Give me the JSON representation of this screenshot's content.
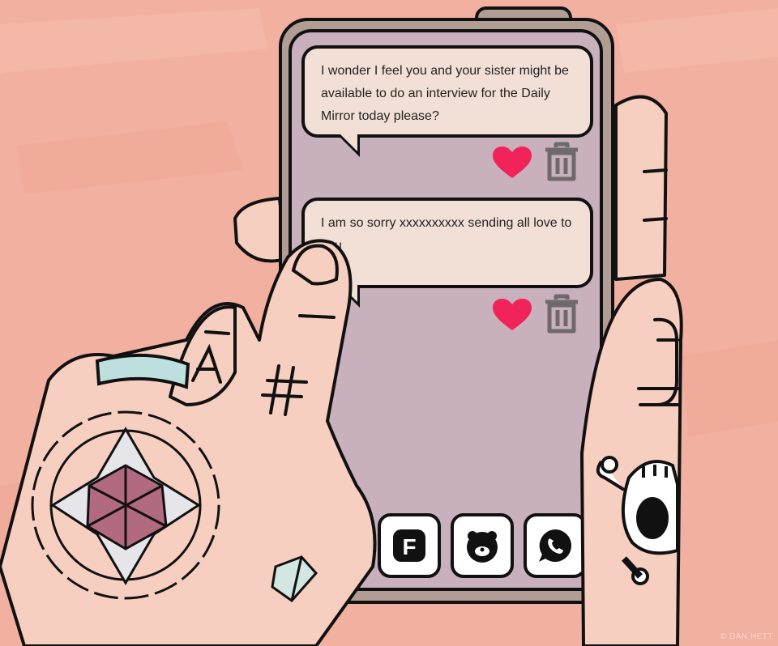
{
  "messages": [
    {
      "text": "I wonder I feel you and your sister might be available to do an interview for the Daily Mirror today please?"
    },
    {
      "text": "I am so sorry xxxxxxxxxx sending all love to you"
    }
  ],
  "actions": {
    "like_icon": "heart-icon",
    "delete_icon": "trash-icon",
    "like_color": "#f0245a",
    "delete_color": "#6e6a6c"
  },
  "dock": [
    {
      "id": "messages",
      "icon": "message-icon"
    },
    {
      "id": "facebook",
      "icon": "facebook-icon",
      "letter": "F"
    },
    {
      "id": "bear-app",
      "icon": "bear-icon"
    },
    {
      "id": "whatsapp",
      "icon": "whatsapp-icon"
    }
  ],
  "colors": {
    "background": "#f2b0a0",
    "skin": "#f7cfc0",
    "screen": "#c8b0bc",
    "phone_frame": "#b19d93",
    "bubble": "#f2e0d6",
    "outline": "#111111"
  },
  "credit": "© DAN HETT"
}
